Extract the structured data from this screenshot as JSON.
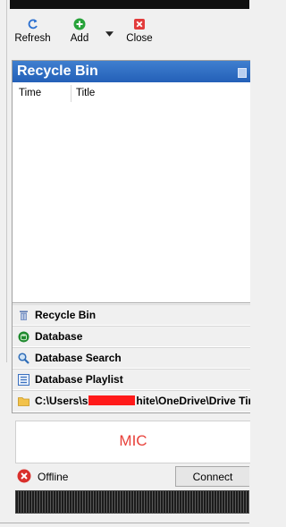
{
  "toolbar": {
    "refresh_label": "Refresh",
    "add_label": "Add",
    "close_label": "Close"
  },
  "panel": {
    "title": "Recycle Bin",
    "columns": [
      "Time",
      "Title"
    ]
  },
  "nav": {
    "items": [
      {
        "label": "Recycle Bin",
        "icon": "trash-icon"
      },
      {
        "label": "Database",
        "icon": "database-icon"
      },
      {
        "label": "Database Search",
        "icon": "search-icon"
      },
      {
        "label": "Database Playlist",
        "icon": "playlist-icon"
      }
    ],
    "path_prefix": "C:\\Users\\s",
    "path_suffix": "hite\\OneDrive\\Drive Tim"
  },
  "mic": {
    "label": "MIC"
  },
  "status": {
    "text": "Offline",
    "connect_label": "Connect"
  },
  "colors": {
    "accent": "#2e6cc4",
    "mic_text": "#e8413a",
    "offline": "#d9302c",
    "add": "#27a33a",
    "close": "#e23b3b"
  }
}
